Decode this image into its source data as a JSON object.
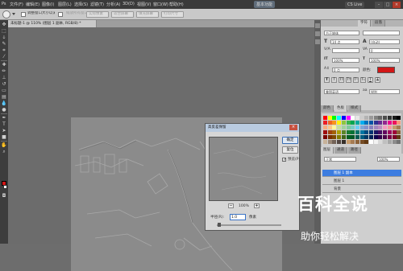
{
  "menubar": {
    "items": [
      "文件(F)",
      "编辑(E)",
      "图像(I)",
      "图层(L)",
      "选择(S)",
      "滤镜(T)",
      "分析(A)",
      "3D(D)",
      "视图(V)",
      "窗口(W)",
      "帮助(H)"
    ],
    "mode_label": "基本功能",
    "cs_live": "CS Live"
  },
  "options": {
    "tool_icon": "zoom-icon",
    "buttons": [
      "调整窗口大小以满屏显示",
      "缩放所有窗口",
      "实际像素",
      "适合屏幕",
      "填充屏幕",
      "打印尺寸"
    ]
  },
  "document": {
    "tab_title": "未标题-1 @ 110% (图层 1 副本, RGB/8) *"
  },
  "tools": [
    "move",
    "marquee",
    "lasso",
    "quick-select",
    "crop",
    "eyedropper",
    "healing",
    "brush",
    "stamp",
    "history-brush",
    "eraser",
    "gradient",
    "blur",
    "dodge",
    "pen",
    "type",
    "path-select",
    "shape",
    "hand",
    "zoom"
  ],
  "colors": {
    "foreground": "#d21717",
    "background": "#ffffff",
    "accent": "#3d7de0"
  },
  "char_panel": {
    "tabs": [
      "字符",
      "段落"
    ],
    "font_name": "方正姚体",
    "font_style": "",
    "size": "14 点",
    "leading": "(自动)",
    "tracking": "0",
    "scale_v": "100%",
    "scale_h": "100%",
    "baseline": "0 点",
    "color_label": "颜色:",
    "language": "美国英语",
    "aa": "锐利"
  },
  "swatches_panel": {
    "tabs": [
      "颜色",
      "色板",
      "样式"
    ]
  },
  "layers_panel": {
    "tabs": [
      "图层",
      "通道",
      "路径"
    ],
    "blend": "正常",
    "opacity": "100%",
    "layers": [
      "图层 1 副本",
      "图层 1",
      "背景"
    ]
  },
  "dialog": {
    "title": "高反差保留",
    "ok": "确定",
    "cancel": "复位",
    "preview_label": "预览(P)",
    "zoom": "100%",
    "radius_label": "半径(R):",
    "radius_value": "1.0",
    "radius_unit": "像素"
  },
  "watermark": {
    "title": "百科全说",
    "subtitle": "助你轻松解决"
  }
}
